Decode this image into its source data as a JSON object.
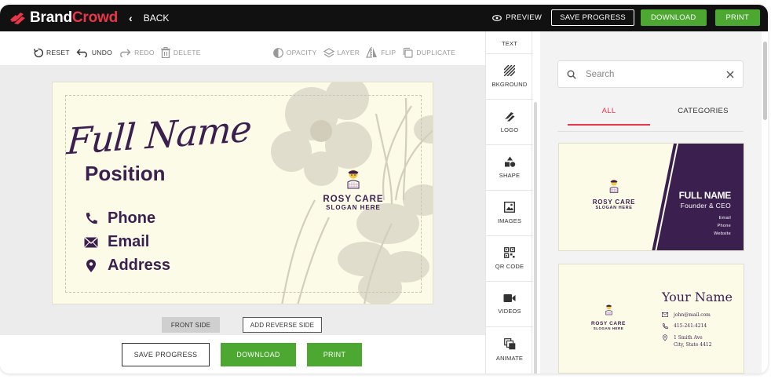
{
  "brand": {
    "part1": "Brand",
    "part2": "Crowd"
  },
  "header": {
    "back_label": "BACK",
    "preview_label": "PREVIEW",
    "save_progress_label": "SAVE PROGRESS",
    "download_label": "DOWNLOAD",
    "print_label": "PRINT"
  },
  "toolbar": {
    "reset": "RESET",
    "undo": "UNDO",
    "redo": "REDO",
    "delete": "DELETE",
    "opacity": "OPACITY",
    "layer": "LAYER",
    "flip": "FLIP",
    "duplicate": "DUPLICATE"
  },
  "card": {
    "full_name": "Full Name",
    "position": "Position",
    "phone": "Phone",
    "email": "Email",
    "address": "Address",
    "brand_name": "ROSY CARE",
    "slogan": "SLOGAN HERE"
  },
  "side_buttons": {
    "front_side": "FRONT SIDE",
    "add_reverse_side": "ADD REVERSE SIDE"
  },
  "bottom_actions": {
    "save_progress": "SAVE PROGRESS",
    "download": "DOWNLOAD",
    "print": "PRINT"
  },
  "sidenav": [
    {
      "label": "TEXT",
      "icon": "text-icon"
    },
    {
      "label": "BKGROUND",
      "icon": "background-icon"
    },
    {
      "label": "LOGO",
      "icon": "logo-icon"
    },
    {
      "label": "SHAPE",
      "icon": "shape-icon"
    },
    {
      "label": "IMAGES",
      "icon": "image-icon"
    },
    {
      "label": "QR CODE",
      "icon": "qr-code-icon"
    },
    {
      "label": "VIDEOS",
      "icon": "video-icon"
    },
    {
      "label": "ANIMATE",
      "icon": "animate-icon"
    }
  ],
  "panel": {
    "search_placeholder": "Search",
    "tab_all": "ALL",
    "tab_categories": "CATEGORIES",
    "active_tab": "ALL"
  },
  "templates": [
    {
      "brand_name": "ROSY CARE",
      "slogan": "SLOGAN HERE",
      "name": "FULL NAME",
      "role": "Founder & CEO",
      "lines": [
        "Email",
        "Phone",
        "Website"
      ]
    },
    {
      "brand_name": "ROSY CARE",
      "slogan": "SLOGAN HERE",
      "name": "Your Name",
      "email": "john@mail.com",
      "phone": "415-241-4214",
      "address_line1": "1 Smith Ave",
      "address_line2": "City, State 4412"
    }
  ],
  "colors": {
    "accent": "#e8364a",
    "green": "#4ca831",
    "purple": "#3b1f4f",
    "card_bg": "#fcfbe8",
    "topbar": "#111111"
  }
}
